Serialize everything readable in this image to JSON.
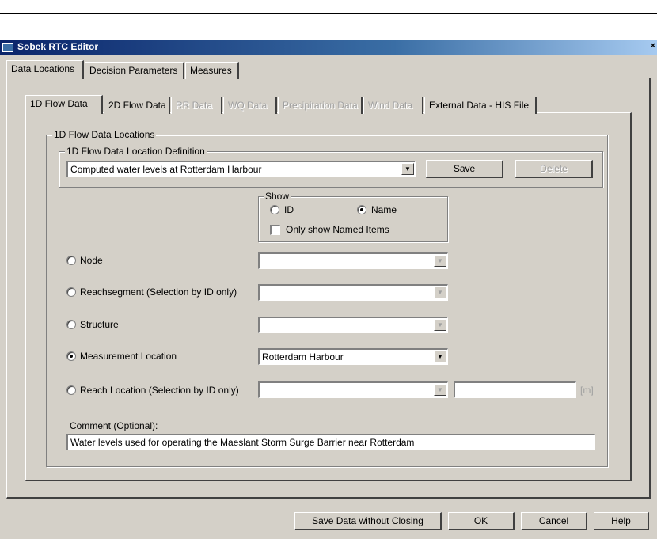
{
  "window": {
    "title": "Sobek RTC Editor",
    "close_glyph": "×"
  },
  "main_tabs": [
    "Data Locations",
    "Decision Parameters",
    "Measures"
  ],
  "sub_tabs": [
    {
      "label": "1D Flow Data",
      "enabled": true
    },
    {
      "label": "2D Flow Data",
      "enabled": true
    },
    {
      "label": "RR Data",
      "enabled": false
    },
    {
      "label": "WQ Data",
      "enabled": false
    },
    {
      "label": "Precipitation Data",
      "enabled": false
    },
    {
      "label": "Wind Data",
      "enabled": false
    },
    {
      "label": "External Data - HIS File",
      "enabled": true
    }
  ],
  "locations_group": {
    "label": "1D Flow Data Locations"
  },
  "definition_group": {
    "label": "1D Flow Data Location Definition",
    "selected": "Computed water levels at Rotterdam Harbour",
    "save_label": "Save",
    "delete_label": "Delete"
  },
  "show_group": {
    "label": "Show",
    "id_label": "ID",
    "name_label": "Name",
    "only_named_label": "Only show Named Items"
  },
  "options": {
    "node": "Node",
    "reachsegment": "Reachsegment (Selection by ID only)",
    "structure": "Structure",
    "measurement": "Measurement Location",
    "measurement_value": "Rotterdam Harbour",
    "reach_location": "Reach Location (Selection by ID only)",
    "unit": "[m]"
  },
  "comment": {
    "label": "Comment (Optional):",
    "value": "Water levels used for operating the Maeslant Storm Surge Barrier near Rotterdam"
  },
  "footer": {
    "save_without_closing": "Save Data without Closing",
    "ok": "OK",
    "cancel": "Cancel",
    "help": "Help"
  }
}
